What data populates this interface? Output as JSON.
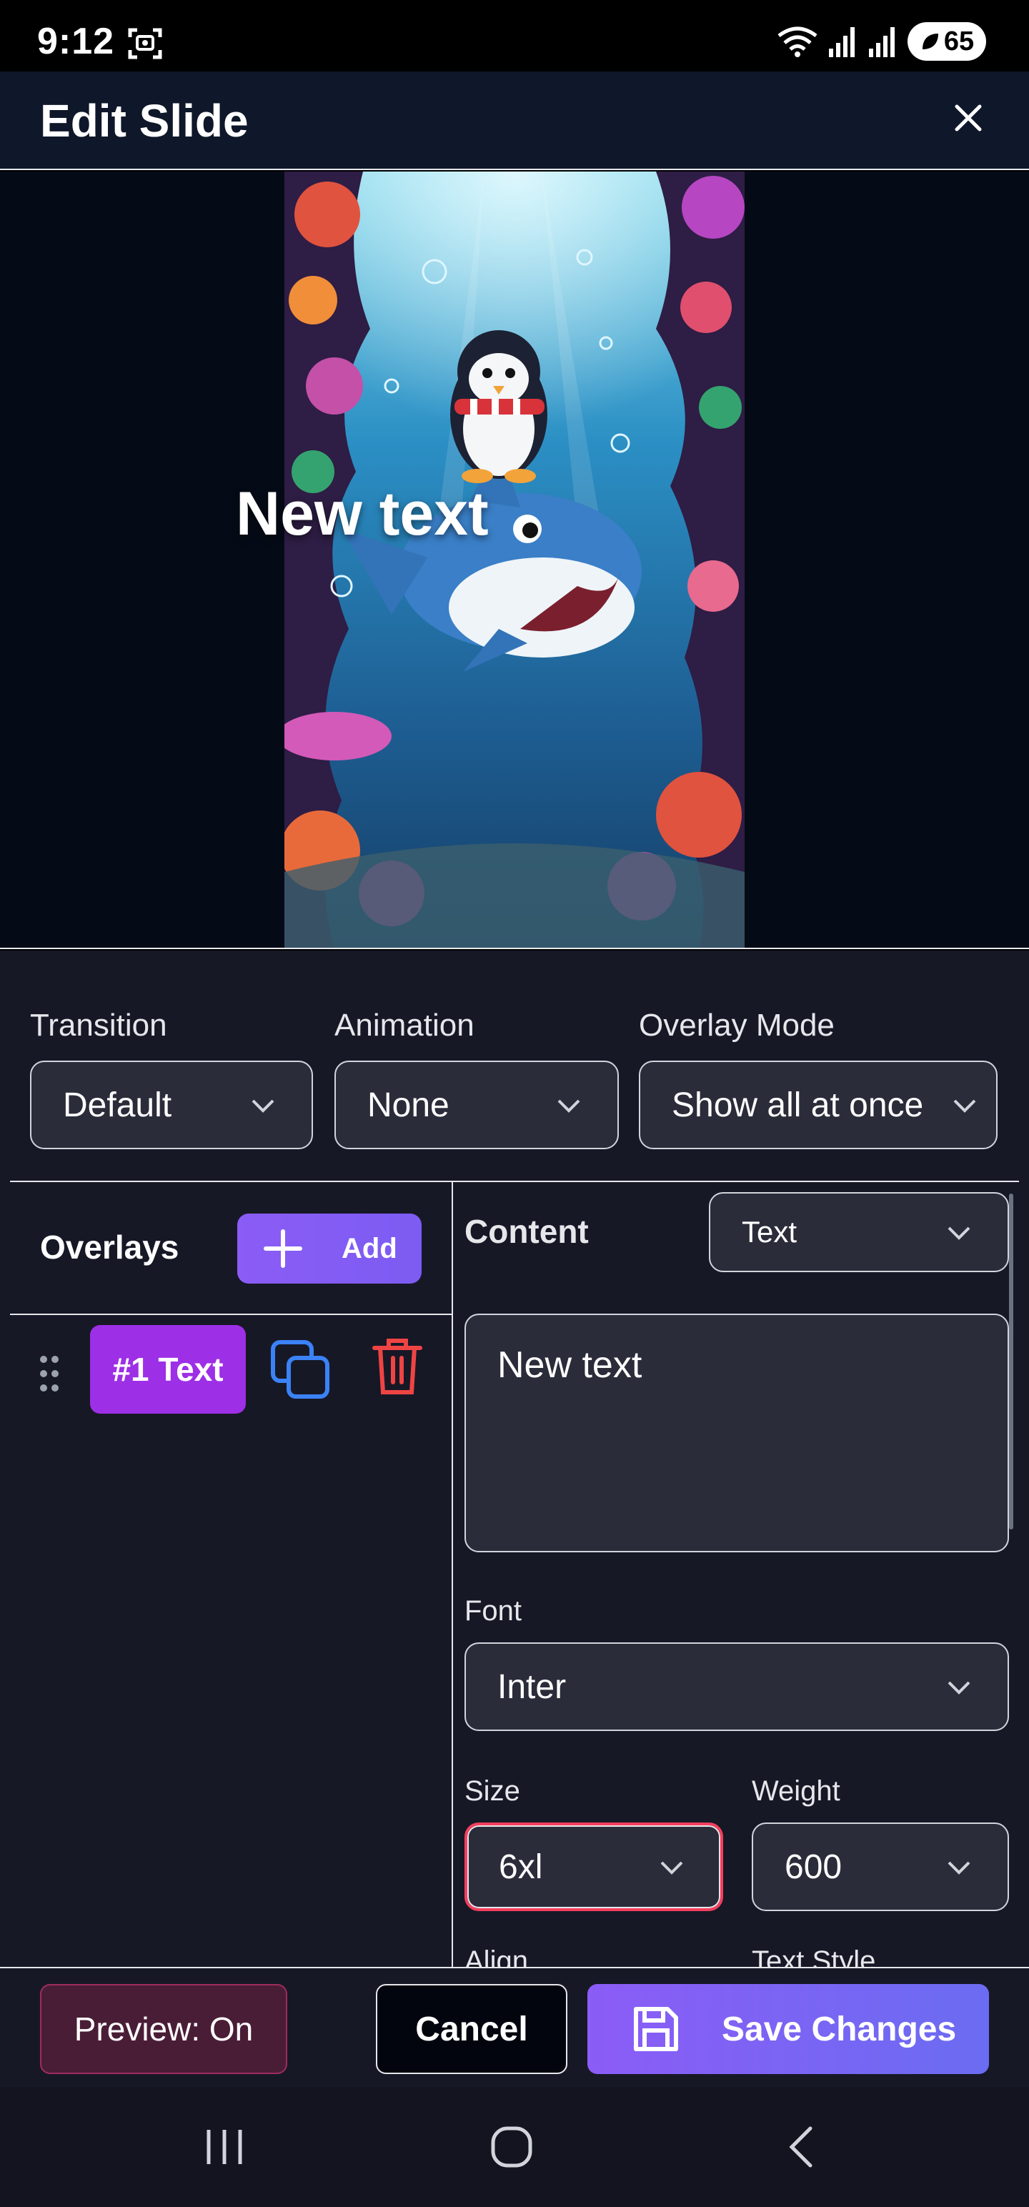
{
  "status_bar": {
    "time": "9:12",
    "battery": "65",
    "icons": [
      "screenshot-icon",
      "wifi-icon",
      "signal-icon",
      "signal-icon",
      "battery-icon"
    ]
  },
  "header": {
    "title": "Edit Slide",
    "close_icon": "close-icon"
  },
  "preview": {
    "overlay_text": "New text",
    "image_description_icon": "slide-image"
  },
  "settings": {
    "transition": {
      "label": "Transition",
      "value": "Default"
    },
    "animation": {
      "label": "Animation",
      "value": "None"
    },
    "overlay_mode": {
      "label": "Overlay Mode",
      "value": "Show all at once"
    }
  },
  "overlays": {
    "title": "Overlays",
    "add_label": "Add",
    "items": [
      {
        "label": "#1 Text"
      }
    ]
  },
  "editor": {
    "content_label": "Content",
    "content_type": "Text",
    "text_value": "New text",
    "font_label": "Font",
    "font_value": "Inter",
    "size_label": "Size",
    "size_value": "6xl",
    "weight_label": "Weight",
    "weight_value": "600",
    "align_label": "Align",
    "text_style_label": "Text Style"
  },
  "actions": {
    "preview_label": "Preview: On",
    "cancel_label": "Cancel",
    "save_label": "Save Changes"
  },
  "colors": {
    "accent": "#8b5cf6",
    "chip": "#9d2fe6",
    "danger": "#ef4444",
    "copy": "#3b82f6",
    "focus": "#f43f5e"
  }
}
